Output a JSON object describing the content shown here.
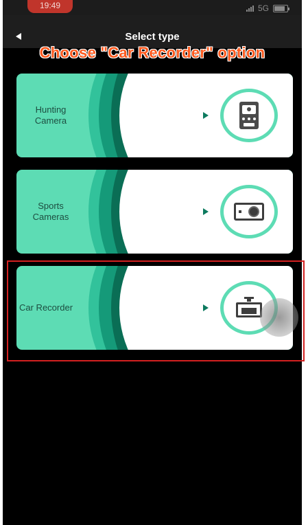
{
  "status_bar": {
    "time": "19:49",
    "network": "5G"
  },
  "nav_bar": {
    "title": "Select type"
  },
  "instruction": "Choose \"Car Recorder\" option",
  "device_types": [
    {
      "label_line1": "Hunting",
      "label_line2": "Camera",
      "icon": "trail-camera-icon"
    },
    {
      "label_line1": "Sports",
      "label_line2": "Cameras",
      "icon": "action-camera-icon"
    },
    {
      "label_line1": "Car Recorder",
      "label_line2": "",
      "icon": "dash-camera-icon"
    }
  ],
  "colors": {
    "card_mint": "#5ddcb4",
    "card_dark_arc": "#0a6e55",
    "annotation_red": "#d42121",
    "instruction_orange": "#ff5a1f",
    "status_pill": "#c0352b"
  }
}
